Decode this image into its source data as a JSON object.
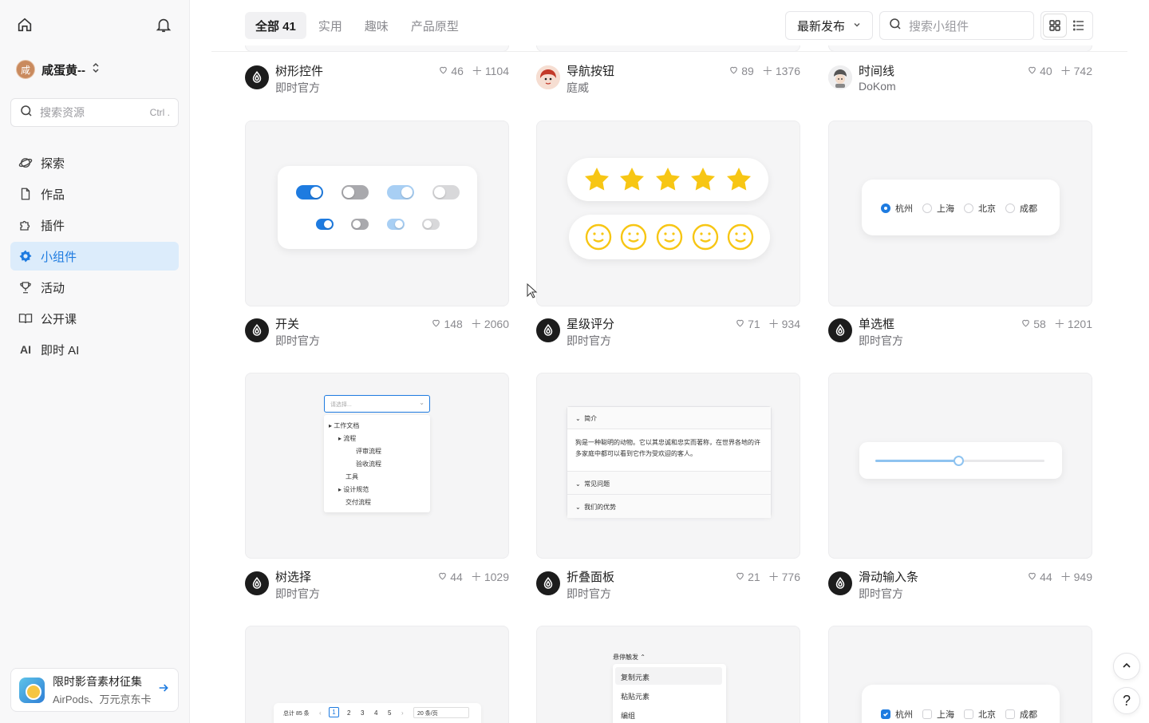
{
  "sidebar": {
    "user": {
      "avatar_char": "咸",
      "name": "咸蛋黄--"
    },
    "search": {
      "placeholder": "搜索资源",
      "shortcut": "Ctrl ."
    },
    "nav": [
      {
        "label": "探索",
        "icon": "explore-icon"
      },
      {
        "label": "作品",
        "icon": "file-icon"
      },
      {
        "label": "插件",
        "icon": "puzzle-icon"
      },
      {
        "label": "小组件",
        "icon": "widget-gear-icon",
        "active": true
      },
      {
        "label": "活动",
        "icon": "trophy-icon"
      },
      {
        "label": "公开课",
        "icon": "book-icon"
      },
      {
        "label": "即时 AI",
        "icon": "ai-icon",
        "icon_text": "AI"
      }
    ],
    "promo": {
      "line1": "限时影音素材征集",
      "line2": "AirPods、万元京东卡"
    }
  },
  "header": {
    "tabs": [
      {
        "label": "全部 41",
        "active": true
      },
      {
        "label": "实用"
      },
      {
        "label": "趣味"
      },
      {
        "label": "产品原型"
      }
    ],
    "sort": {
      "label": "最新发布"
    },
    "search": {
      "placeholder": "搜索小组件"
    }
  },
  "cards_top": [
    {
      "title": "树形控件",
      "author": "即时官方",
      "likes": "46",
      "uses": "1104",
      "logo": "official"
    },
    {
      "title": "导航按钮",
      "author": "庭威",
      "likes": "89",
      "uses": "1376",
      "logo": "girl"
    },
    {
      "title": "时间线",
      "author": "DoKom",
      "likes": "40",
      "uses": "742",
      "logo": "boy"
    }
  ],
  "cards_row1": [
    {
      "title": "开关",
      "author": "即时官方",
      "likes": "148",
      "uses": "2060"
    },
    {
      "title": "星级评分",
      "author": "即时官方",
      "likes": "71",
      "uses": "934"
    },
    {
      "title": "单选框",
      "author": "即时官方",
      "likes": "58",
      "uses": "1201"
    }
  ],
  "cards_row2": [
    {
      "title": "树选择",
      "author": "即时官方",
      "likes": "44",
      "uses": "1029"
    },
    {
      "title": "折叠面板",
      "author": "即时官方",
      "likes": "21",
      "uses": "776"
    },
    {
      "title": "滑动输入条",
      "author": "即时官方",
      "likes": "44",
      "uses": "949"
    }
  ],
  "previews": {
    "radio": {
      "options": [
        "杭州",
        "上海",
        "北京",
        "成都"
      ],
      "selected": 0
    },
    "tree_select": {
      "placeholder": "请选择...",
      "nodes": [
        "工作文档",
        "流程",
        "评审流程",
        "验收流程",
        "工具",
        "设计规范",
        "交付流程"
      ]
    },
    "collapse": {
      "sections": [
        "简介",
        "常见问题",
        "我们的优势"
      ],
      "body": "狗是一种聪明的动物。它以其忠诚和忠实而著称，在世界各地的许多家庭中都可以看到它作为受欢迎的客人。"
    },
    "slider": {
      "value": 0.49
    },
    "rating": {
      "stars": 5,
      "smileys": 5
    },
    "pagination": {
      "total": "总计 85 条",
      "pages": [
        "1",
        "2",
        "3",
        "4",
        "5"
      ],
      "page_size": "20 条/页"
    },
    "dropdown": {
      "trigger": "悬停触发",
      "items": [
        "复制元素",
        "粘贴元素",
        "编组"
      ]
    },
    "checkbox": {
      "options": [
        "杭州",
        "上海",
        "北京",
        "成都"
      ],
      "checked": 0
    }
  },
  "colors": {
    "accent": "#1e7be0",
    "active_bg": "#dcecfb",
    "star": "#f7c614"
  },
  "float": {
    "help": "?"
  }
}
